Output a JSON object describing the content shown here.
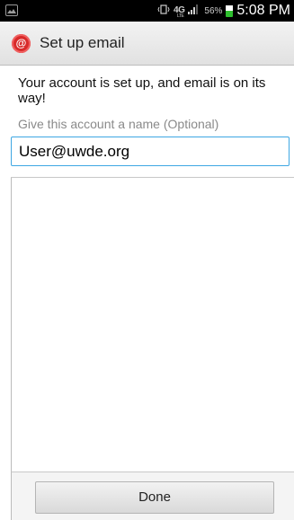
{
  "status_bar": {
    "battery_percent": "56%",
    "time": "5:08 PM",
    "network": "4G",
    "network_sub": "LTE",
    "icons": [
      "image-icon",
      "vibrate-icon",
      "lte-icon",
      "signal-icon",
      "battery-icon"
    ]
  },
  "action_bar": {
    "title": "Set up email",
    "app_icon": "email-app-icon",
    "app_icon_glyph": "@"
  },
  "content": {
    "message": "Your account is set up, and email is on its way!",
    "account_name_label": "Give this account a name (Optional)",
    "account_name_value": "User@uwde.org"
  },
  "footer": {
    "done_label": "Done"
  },
  "colors": {
    "input_border": "#3ea7e3",
    "app_icon": "#d82a2a",
    "battery": "#2ebf2e"
  }
}
